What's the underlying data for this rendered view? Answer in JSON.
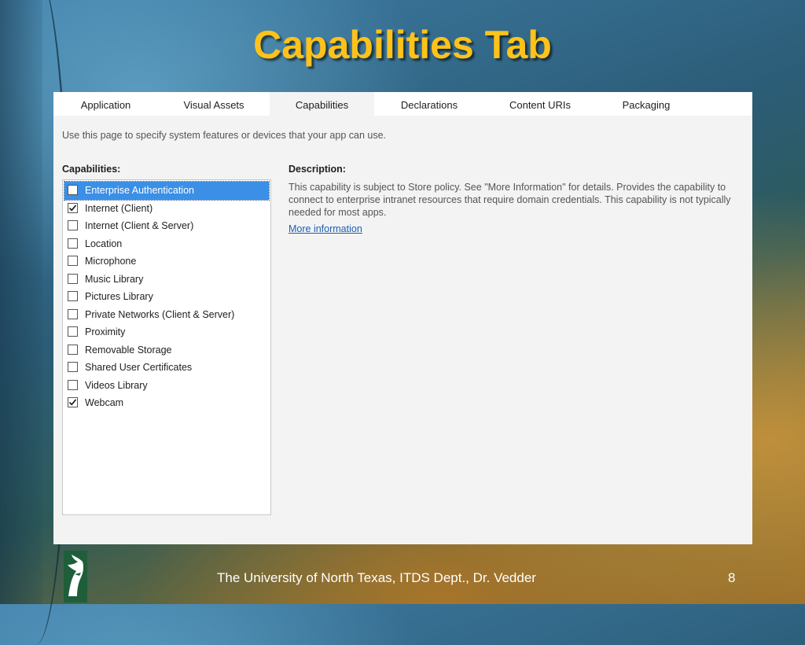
{
  "slide": {
    "title": "Capabilities Tab",
    "footer": "The University of North Texas, ITDS Dept., Dr. Vedder",
    "page_number": "8"
  },
  "tabs": [
    {
      "label": "Application",
      "active": false
    },
    {
      "label": "Visual Assets",
      "active": false
    },
    {
      "label": "Capabilities",
      "active": true
    },
    {
      "label": "Declarations",
      "active": false
    },
    {
      "label": "Content URIs",
      "active": false
    },
    {
      "label": "Packaging",
      "active": false
    }
  ],
  "hint": "Use this page to specify system features or devices that your app can use.",
  "capabilities": {
    "heading": "Capabilities:",
    "items": [
      {
        "label": "Enterprise Authentication",
        "checked": false,
        "selected": true
      },
      {
        "label": "Internet (Client)",
        "checked": true,
        "selected": false
      },
      {
        "label": "Internet (Client & Server)",
        "checked": false,
        "selected": false
      },
      {
        "label": "Location",
        "checked": false,
        "selected": false
      },
      {
        "label": "Microphone",
        "checked": false,
        "selected": false
      },
      {
        "label": "Music Library",
        "checked": false,
        "selected": false
      },
      {
        "label": "Pictures Library",
        "checked": false,
        "selected": false
      },
      {
        "label": "Private Networks (Client & Server)",
        "checked": false,
        "selected": false
      },
      {
        "label": "Proximity",
        "checked": false,
        "selected": false
      },
      {
        "label": "Removable Storage",
        "checked": false,
        "selected": false
      },
      {
        "label": "Shared User Certificates",
        "checked": false,
        "selected": false
      },
      {
        "label": "Videos Library",
        "checked": false,
        "selected": false
      },
      {
        "label": "Webcam",
        "checked": true,
        "selected": false
      }
    ]
  },
  "description": {
    "heading": "Description:",
    "text": "This capability is subject to Store policy. See \"More Information\" for details. Provides the capability to connect to enterprise intranet resources that require domain credentials. This capability is not typically needed for most apps.",
    "link": "More information"
  },
  "colors": {
    "title": "#ffc21a",
    "selection": "#3b8fe6",
    "link": "#1a5fb4"
  },
  "icons": {
    "logo": "eagle-logo-icon",
    "check": "checkmark-icon"
  }
}
